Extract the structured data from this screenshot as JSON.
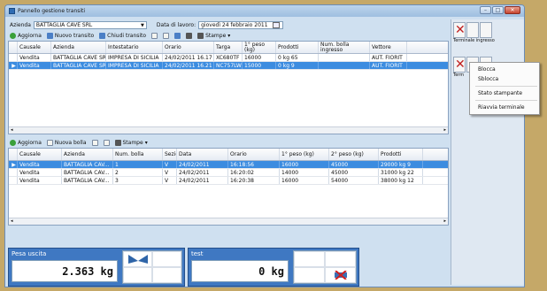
{
  "window": {
    "title": "Pannello gestione transiti"
  },
  "top": {
    "azienda_label": "Azienda",
    "azienda_value": "BATTAGLIA CAVE SRL",
    "data_lavoro_label": "Data di lavoro:",
    "data_lavoro_value": "giovedì 24 febbraio 2011"
  },
  "toolbar1": {
    "aggiorna": "Aggiorna",
    "nuovo_transito": "Nuovo transito",
    "chiudi_transito": "Chiudi transito",
    "stampe": "Stampe"
  },
  "grid1": {
    "headers": [
      "Causale",
      "Azienda",
      "Intestatario",
      "Orario",
      "Targa",
      "1° peso (kg)",
      "Prodotti",
      "Num. bolla ingresso",
      "Vettore"
    ],
    "rows": [
      [
        "Vendita",
        "BATTAGLIA CAVE SRL",
        "IMPRESA DI SICILIA",
        "24/02/2011 16.17",
        "XC680TF",
        "16000",
        "0 kg 65",
        "",
        "AUT. FIORIT"
      ],
      [
        "Vendita",
        "BATTAGLIA CAVE SRL",
        "IMPRESA DI SICILIA",
        "24/02/2011 16.21",
        "NC757LW",
        "15000",
        "0 kg 9",
        "",
        "AUT. FIORIT"
      ]
    ]
  },
  "toolbar2": {
    "aggiorna": "Aggiorna",
    "nuova_bolla": "Nuova bolla",
    "stampe": "Stampe"
  },
  "grid2": {
    "headers": [
      "Causale",
      "Azienda",
      "Num. bolla",
      "Sezio",
      "Data",
      "Orario",
      "1° peso (kg)",
      "2° peso (kg)",
      "Prodotti"
    ],
    "rows": [
      [
        "Vendita",
        "BATTAGLIA CAV...",
        "1",
        "V",
        "24/02/2011",
        "16:18:56",
        "16000",
        "45000",
        "29000 kg 9"
      ],
      [
        "Vendita",
        "BATTAGLIA CAV...",
        "2",
        "V",
        "24/02/2011",
        "16:20:02",
        "14000",
        "45000",
        "31000 kg 22"
      ],
      [
        "Vendita",
        "BATTAGLIA CAV...",
        "3",
        "V",
        "24/02/2011",
        "16:20:38",
        "16000",
        "54000",
        "38000 kg 12"
      ]
    ]
  },
  "pesa_uscita": {
    "title": "Pesa uscita",
    "weight": "2.363 kg"
  },
  "test": {
    "title": "test",
    "weight": "0 kg"
  },
  "terminals": [
    {
      "label": "Terminale ingresso"
    },
    {
      "label": "Term"
    }
  ],
  "context_menu": [
    "Blocca",
    "Sblocca",
    "Stato stampante",
    "Riavvia terminale"
  ],
  "colors": {
    "selection": "#3c8ce0",
    "panel": "#3f78c2",
    "frame": "#c5a868"
  }
}
